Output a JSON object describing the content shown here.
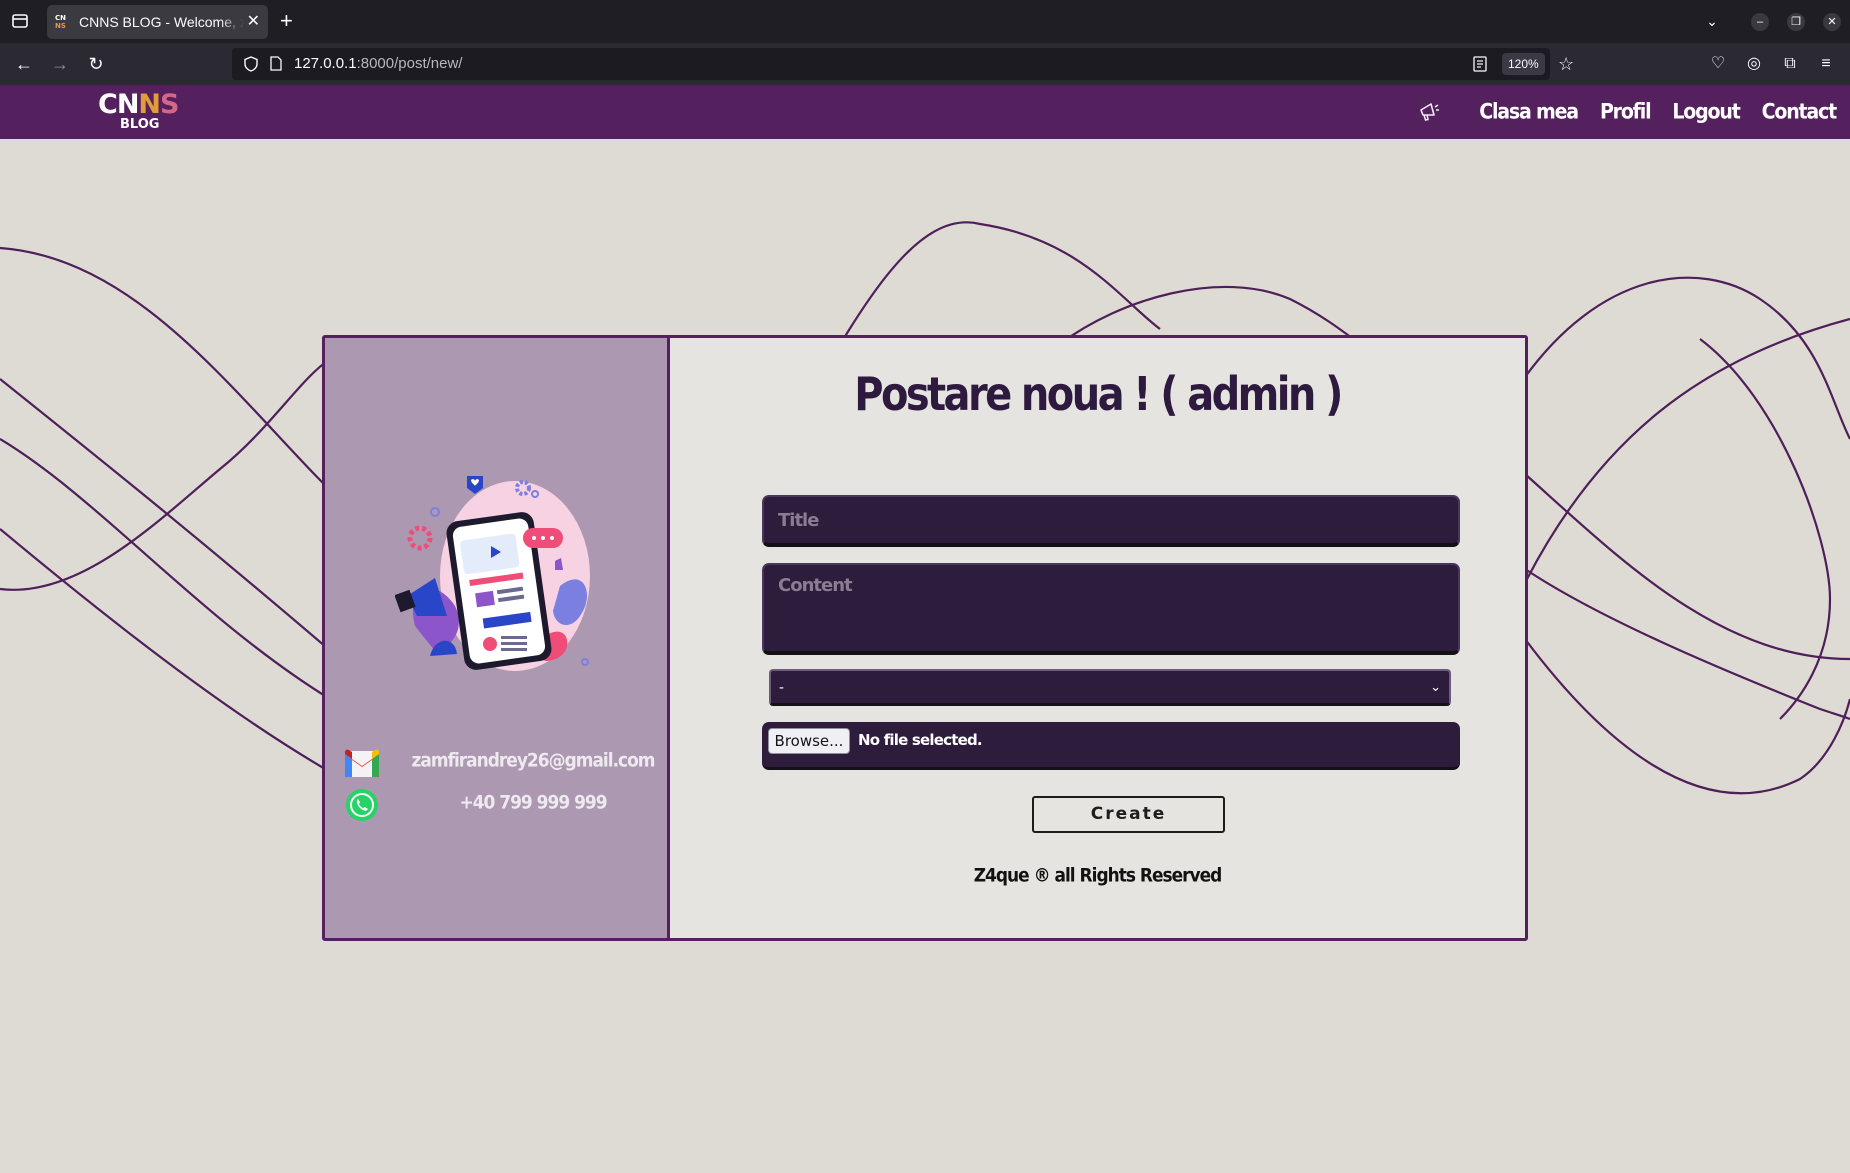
{
  "browser": {
    "tab": {
      "title": "CNNS BLOG - Welcome, z",
      "favicon_text_top": "CN",
      "favicon_text_bottom": "NS"
    },
    "url": {
      "host": "127.0.0.1",
      "rest": ":8000/post/new/"
    },
    "zoom": "120%",
    "icons": [
      "tab-list-icon",
      "close-icon",
      "plus-icon",
      "chevron-down-icon",
      "minimize-icon",
      "restore-icon",
      "close-window-icon",
      "back-arrow-icon",
      "forward-arrow-icon",
      "reload-icon",
      "shield-icon",
      "page-icon",
      "reader-view-icon",
      "star-icon",
      "pocket-icon",
      "account-icon",
      "extensions-icon",
      "menu-icon"
    ]
  },
  "site": {
    "logo": {
      "line1_a": "CN",
      "line1_b": "N",
      "line1_c": "S",
      "line2": "BLOG"
    },
    "nav": {
      "megaphone_icon": "megaphone-icon",
      "links": [
        "Clasa mea",
        "Profil",
        "Logout",
        "Contact"
      ]
    },
    "colors": {
      "header": "#54205e",
      "panel": "#ad98b2",
      "field": "#2d1c3b",
      "background": "#dedad4"
    }
  },
  "form": {
    "title": "Postare noua ! ( admin )",
    "title_placeholder": "Title",
    "content_placeholder": "Content",
    "select_value": "-",
    "browse_label": "Browse...",
    "file_status": "No file selected.",
    "submit_label": "Create",
    "footer": "Z4que ® all Rights Reserved"
  },
  "contact": {
    "email": "zamfirandrey26@gmail.com",
    "phone": "+40 799 999 999",
    "icons": [
      "gmail-icon",
      "whatsapp-icon"
    ]
  }
}
